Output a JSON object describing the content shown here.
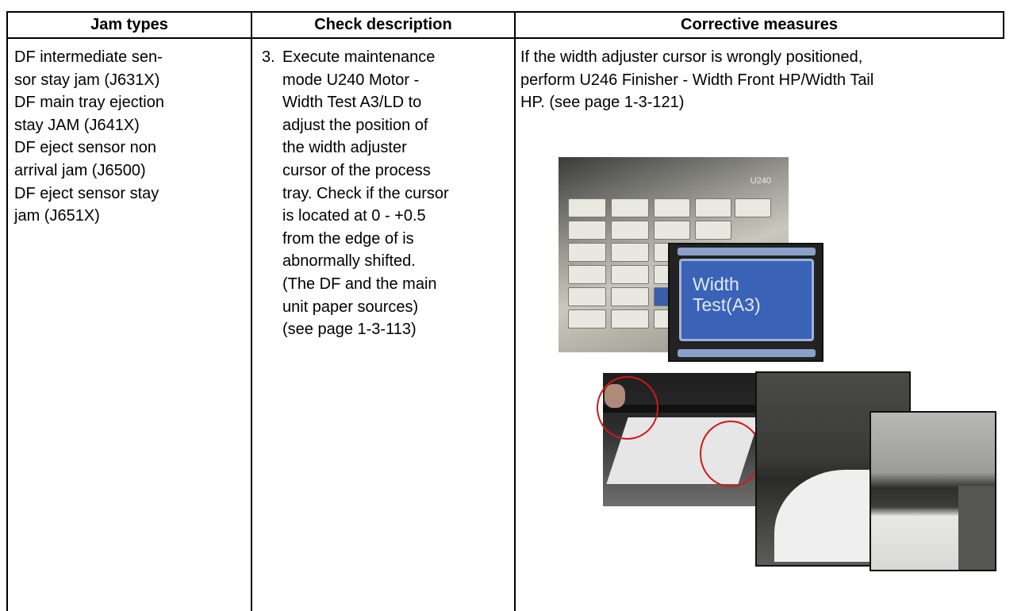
{
  "table": {
    "headers": [
      "Jam types",
      "Check description",
      "Corrective measures"
    ],
    "jam_types_lines": [
      "DF intermediate sen-",
      "sor stay jam (J631X)",
      "DF main tray ejection",
      "stay JAM (J641X)",
      "DF eject sensor non",
      "arrival jam (J6500)",
      "DF eject sensor stay",
      "jam (J651X)"
    ],
    "check_number": "3.",
    "check_lines": [
      "Execute maintenance",
      "mode U240 Motor -",
      "Width Test A3/LD to",
      "adjust the position of",
      "the width adjuster",
      "cursor of the process",
      "tray. Check if the cursor",
      "is located at 0 - +0.5",
      "from the edge of is",
      "abnormally shifted.",
      "(The DF and the main",
      "unit paper sources)",
      "(see page 1-3-113)"
    ],
    "corrective_lines": [
      "If the width adjuster cursor is wrongly positioned,",
      "perform U246 Finisher - Width Front HP/Width Tail",
      "HP. (see page 1-3-121)"
    ]
  },
  "photos": {
    "screen_code": "U240",
    "zoom_button_line1": "Width",
    "zoom_button_line2": "Test(A3)"
  }
}
